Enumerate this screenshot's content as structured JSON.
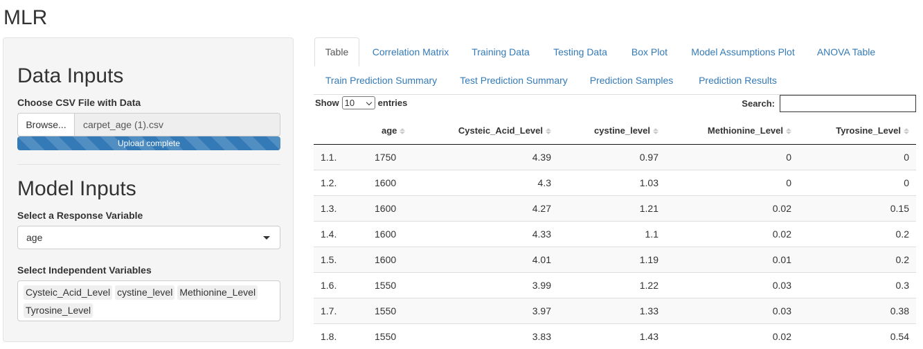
{
  "app": {
    "title": "MLR"
  },
  "sidebar": {
    "data_inputs_title": "Data Inputs",
    "file_label": "Choose CSV File with Data",
    "browse_label": "Browse...",
    "file_name": "carpet_age (1).csv",
    "progress_text": "Upload complete",
    "progress_value": 1.0,
    "model_inputs_title": "Model Inputs",
    "response_label": "Select a Response Variable",
    "response_value": "age",
    "independent_label": "Select Independent Variables",
    "independent_selected": [
      "Cysteic_Acid_Level",
      "cystine_level",
      "Methionine_Level",
      "Tyrosine_Level"
    ]
  },
  "tabs": [
    {
      "label": "Table",
      "active": true
    },
    {
      "label": "Correlation Matrix",
      "active": false
    },
    {
      "label": "Training Data",
      "active": false
    },
    {
      "label": "Testing Data",
      "active": false
    },
    {
      "label": "Box Plot",
      "active": false
    },
    {
      "label": "Model Assumptions Plot",
      "active": false
    },
    {
      "label": "ANOVA Table",
      "active": false
    },
    {
      "label": "Train Prediction Summary",
      "active": false
    },
    {
      "label": "Test Prediction Summary",
      "active": false
    },
    {
      "label": "Prediction Samples",
      "active": false
    },
    {
      "label": "Prediction Results",
      "active": false
    }
  ],
  "table_controls": {
    "show_label": "Show",
    "page_length": "10",
    "entries_label": "entries",
    "search_label": "Search:",
    "search_value": ""
  },
  "table": {
    "columns": [
      "",
      "age",
      "Cysteic_Acid_Level",
      "cystine_level",
      "Methionine_Level",
      "Tyrosine_Level"
    ],
    "rows": [
      [
        "1.1.",
        "1750",
        "4.39",
        "0.97",
        "0",
        "0"
      ],
      [
        "1.2.",
        "1600",
        "4.3",
        "1.03",
        "0",
        "0"
      ],
      [
        "1.3.",
        "1600",
        "4.27",
        "1.21",
        "0.02",
        "0.15"
      ],
      [
        "1.4.",
        "1600",
        "4.33",
        "1.1",
        "0.02",
        "0.2"
      ],
      [
        "1.5.",
        "1600",
        "4.01",
        "1.19",
        "0.01",
        "0.2"
      ],
      [
        "1.6.",
        "1550",
        "3.99",
        "1.22",
        "0.03",
        "0.3"
      ],
      [
        "1.7.",
        "1550",
        "3.97",
        "1.33",
        "0.03",
        "0.38"
      ],
      [
        "1.8.",
        "1550",
        "3.83",
        "1.43",
        "0.02",
        "0.54"
      ]
    ]
  }
}
